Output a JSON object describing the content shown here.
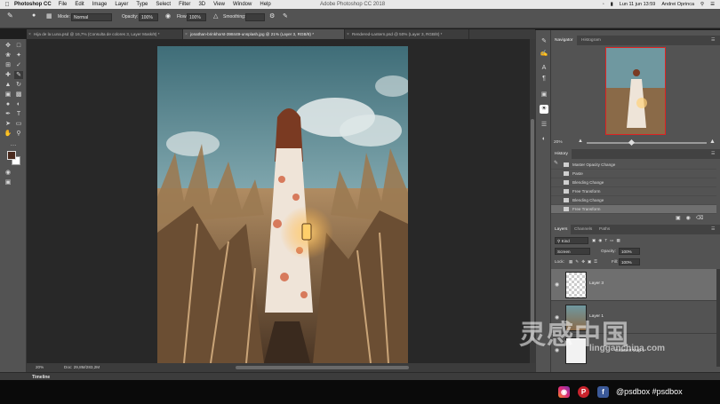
{
  "menubar": {
    "app_name": "Photoshop CC",
    "items": [
      "File",
      "Edit",
      "Image",
      "Layer",
      "Type",
      "Select",
      "Filter",
      "3D",
      "View",
      "Window",
      "Help"
    ],
    "window_title": "Adobe Photoshop CC 2018",
    "clock": "Lun 11 jun 13:59",
    "user": "Andrei Oprinca"
  },
  "options": {
    "mode_label": "Mode:",
    "mode_value": "Normal",
    "opacity_label": "Opacity:",
    "opacity_value": "100%",
    "flow_label": "Flow:",
    "flow_value": "100%",
    "smoothing_label": "Smoothing:"
  },
  "tabs": [
    {
      "label": "Hija de la Luna.psd @ 16,7% (Consulta de colores 3, Layer Mask/8) *"
    },
    {
      "label": "jonathan-brinkhorst-398449-unsplash.jpg @ 21% (Layer 3, RGB/8) *"
    },
    {
      "label": "Rendered-Lantern.psd @ 50% (Layer 3, RGB/8) *"
    }
  ],
  "status": {
    "zoom": "20%",
    "doc": "Doc: 29,8M/283,2M"
  },
  "timeline": {
    "label": "Timeline"
  },
  "navigator": {
    "tabs": [
      "Navigator",
      "Histogram"
    ],
    "zoom": "20%"
  },
  "history": {
    "tab": "History",
    "items": [
      "Master Opacity Change",
      "Paste",
      "Blending Change",
      "Free Transform",
      "Blending Change",
      "Free Transform"
    ],
    "selected_index": 5
  },
  "layers": {
    "tabs": [
      "Layers",
      "Channels",
      "Paths"
    ],
    "kind": "Kind",
    "blend": "Screen",
    "opacity_label": "Opacity:",
    "opacity_value": "100%",
    "lock_label": "Lock:",
    "fill_label": "Fill:",
    "fill_value": "100%",
    "items": [
      {
        "name": "Layer 3",
        "selected": true
      },
      {
        "name": "Layer 1",
        "selected": false
      },
      {
        "name": "Gradient Map 1",
        "selected": false
      }
    ]
  },
  "watermark": {
    "main": "灵感中国",
    "sub": "lingganchina.com"
  },
  "footer": {
    "handle": "@psdbox #psdbox"
  }
}
